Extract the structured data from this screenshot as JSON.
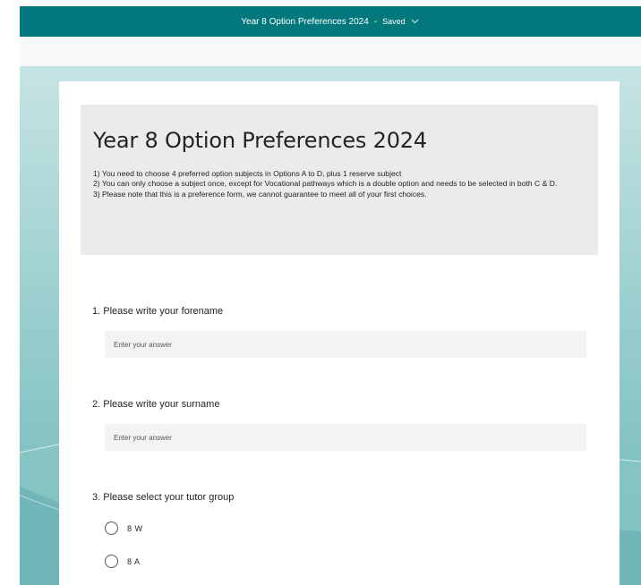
{
  "topbar": {
    "title": "Year 8 Option Preferences 2024",
    "separator": "-",
    "status": "Saved",
    "chevron_icon": "chevron-down-icon"
  },
  "form": {
    "title": "Year 8 Option Preferences 2024",
    "description": [
      "1) You need to choose 4 preferred option subjects in Options A to D, plus 1 reserve subject",
      "2) You can only choose a subject once, except for Vocational pathways which is a double option and needs to be selected in both C & D.",
      "3) Please note that this is a preference form, we cannot guarantee to meet all of your first choices."
    ],
    "questions": [
      {
        "title": "1. Please write your forename",
        "placeholder": "Enter your answer"
      },
      {
        "title": "2. Please write your surname",
        "placeholder": "Enter your answer"
      },
      {
        "title": "3. Please select your tutor group",
        "options": [
          "8 W",
          "8 A"
        ]
      }
    ]
  },
  "colors": {
    "brand": "#03787c",
    "header_bg": "#ebebeb",
    "input_bg": "#f3f3f3"
  }
}
